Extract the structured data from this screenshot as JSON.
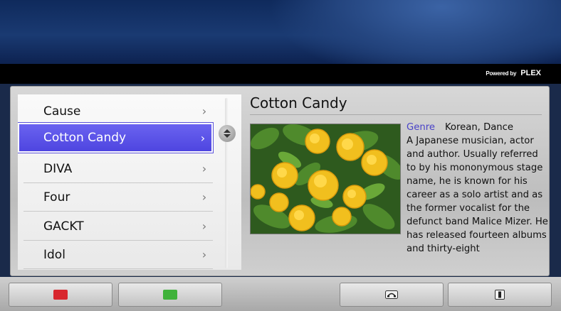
{
  "header": {
    "powered_by": "Powered by",
    "brand": "PLEX"
  },
  "list": {
    "items": [
      {
        "label": "Cause",
        "selected": false
      },
      {
        "label": "Cotton Candy",
        "selected": true
      },
      {
        "label": "DIVA",
        "selected": false
      },
      {
        "label": "Four",
        "selected": false
      },
      {
        "label": "GACKT",
        "selected": false
      },
      {
        "label": "Idol",
        "selected": false
      }
    ],
    "chevron": "›"
  },
  "detail": {
    "title": "Cotton Candy",
    "genre_label": "Genre",
    "genre_value": "Korean, Dance",
    "description": "A Japanese musician, actor and author. Usually referred to by his mononymous stage name, he is known for his career as a solo artist and as the former vocalist for the defunct band Malice Mizer. He has released fourteen albums and thirty-eight",
    "image_icon": "flower-thumbnail"
  },
  "footer": {
    "buttons": [
      {
        "icon": "red-button-icon",
        "color": "#d8262d"
      },
      {
        "icon": "green-button-icon",
        "color": "#3fb23a"
      },
      {
        "icon": "phone-icon"
      },
      {
        "icon": "remote-icon"
      }
    ]
  },
  "colors": {
    "accent": "#5a52e4",
    "genre_label": "#4a43c8"
  }
}
